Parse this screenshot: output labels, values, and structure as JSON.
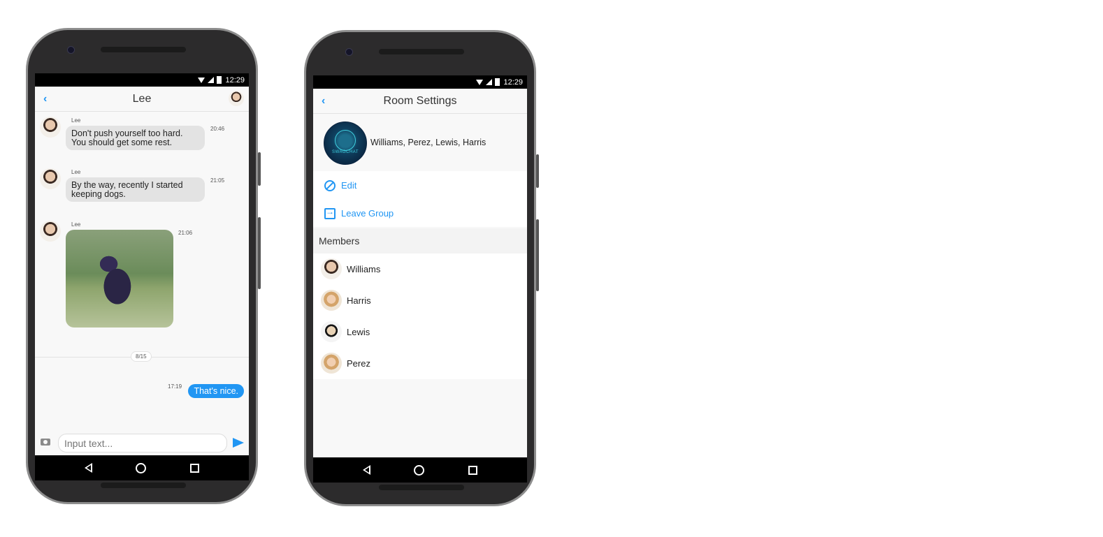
{
  "status_bar": {
    "time": "12:29"
  },
  "chat": {
    "title": "Lee",
    "messages": [
      {
        "sender": "Lee",
        "text_line1": "Don't push yourself too hard.",
        "text_line2": "You should get some rest.",
        "time": "20:46"
      },
      {
        "sender": "Lee",
        "text_line1": "By the way, recently I started",
        "text_line2": "keeping dogs.",
        "time": "21:05"
      },
      {
        "sender": "Lee",
        "type": "image",
        "time": "21:06"
      }
    ],
    "date_divider": "8/15",
    "my_message": {
      "text": "That's nice.",
      "time": "17:19"
    },
    "input_placeholder": "Input text..."
  },
  "settings": {
    "title": "Room Settings",
    "group_names": "Williams, Perez, Lewis, Harris",
    "group_avatar_text": "SWAGCHAT",
    "actions": [
      {
        "label": "Edit",
        "icon": "prohibit-icon"
      },
      {
        "label": "Leave Group",
        "icon": "exit-icon"
      }
    ],
    "members_title": "Members",
    "members": [
      {
        "name": "Williams"
      },
      {
        "name": "Harris"
      },
      {
        "name": "Lewis"
      },
      {
        "name": "Perez"
      }
    ]
  },
  "colors": {
    "accent": "#2196f3",
    "phone_body": "#2c2b2c"
  }
}
